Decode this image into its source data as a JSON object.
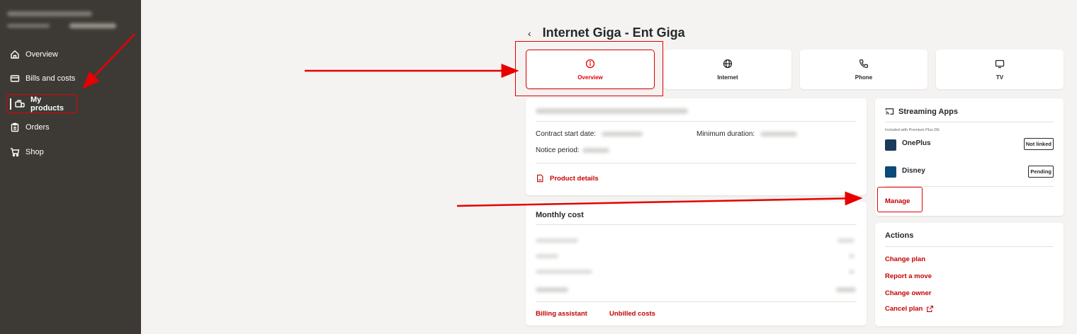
{
  "sidebar": {
    "items": [
      {
        "label": "Overview",
        "icon": "home-icon"
      },
      {
        "label": "Bills and costs",
        "icon": "bill-icon"
      },
      {
        "label": "My products",
        "icon": "products-icon"
      },
      {
        "label": "Orders",
        "icon": "clipboard-icon"
      },
      {
        "label": "Shop",
        "icon": "cart-icon"
      }
    ]
  },
  "page": {
    "back": "‹",
    "title": "Internet Giga - Ent Giga"
  },
  "tabs": [
    {
      "label": "Overview",
      "icon": "info-icon"
    },
    {
      "label": "Internet",
      "icon": "globe-icon"
    },
    {
      "label": "Phone",
      "icon": "phone-icon"
    },
    {
      "label": "TV",
      "icon": "tv-icon"
    }
  ],
  "contract": {
    "start_label": "Contract start date:",
    "min_duration_label": "Minimum duration:",
    "notice_label": "Notice period:",
    "product_details": "Product details"
  },
  "monthly": {
    "title": "Monthly cost",
    "billing_assistant": "Billing assistant",
    "unbilled_costs": "Unbilled costs"
  },
  "streaming": {
    "title": "Streaming Apps",
    "subtitle": "Included with Premium Plus DE",
    "apps": [
      {
        "name": "OnePlus",
        "status": "Not linked"
      },
      {
        "name": "Disney",
        "status": "Pending"
      }
    ],
    "manage": "Manage"
  },
  "actions": {
    "title": "Actions",
    "items": [
      "Change plan",
      "Report a move",
      "Change owner",
      "Cancel plan"
    ]
  },
  "colors": {
    "accent": "#e60000",
    "link": "#c40000",
    "sidebar_bg": "#3d3a35",
    "page_bg": "#f4f3f1"
  }
}
